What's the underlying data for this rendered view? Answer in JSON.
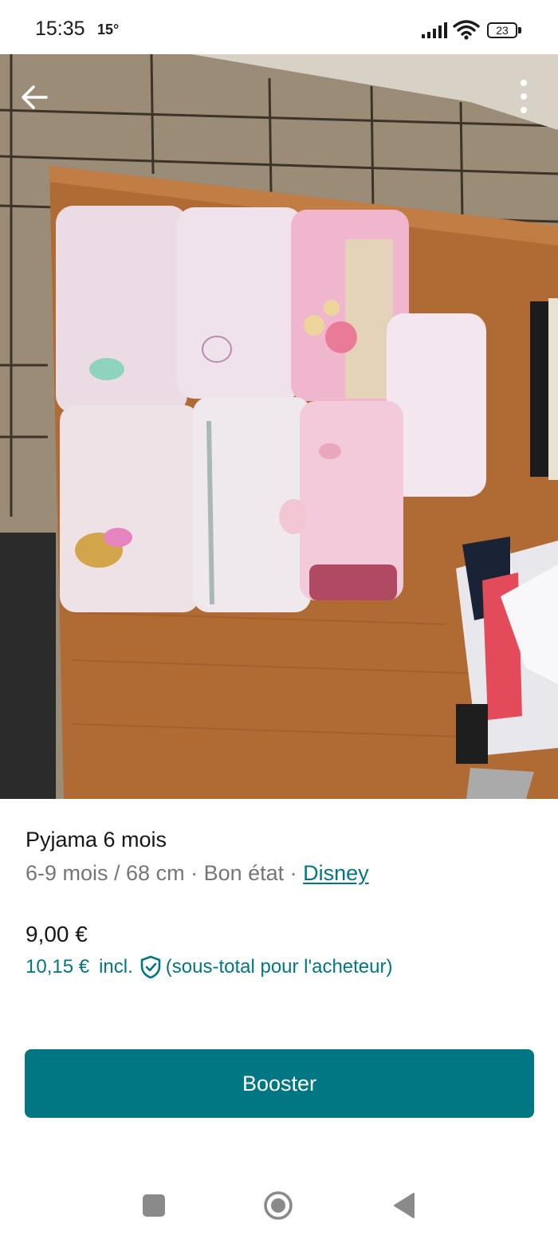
{
  "status_bar": {
    "time": "15:35",
    "temperature": "15°",
    "battery": "23"
  },
  "photo": {
    "description_icons": [
      "arrow-left-icon",
      "more-vertical-icon"
    ]
  },
  "listing": {
    "title": "Pyjama 6 mois",
    "size": "6-9 mois / 68 cm",
    "separator": " · ",
    "condition": "Bon état",
    "brand": "Disney",
    "price": "9,00 €",
    "price_incl_amount": "10,15 €",
    "price_incl_label": "incl.",
    "price_incl_note": "(sous-total pour l'acheteur)"
  },
  "actions": {
    "booster_label": "Booster"
  },
  "colors": {
    "accent": "#007782",
    "muted_text": "#767676"
  }
}
